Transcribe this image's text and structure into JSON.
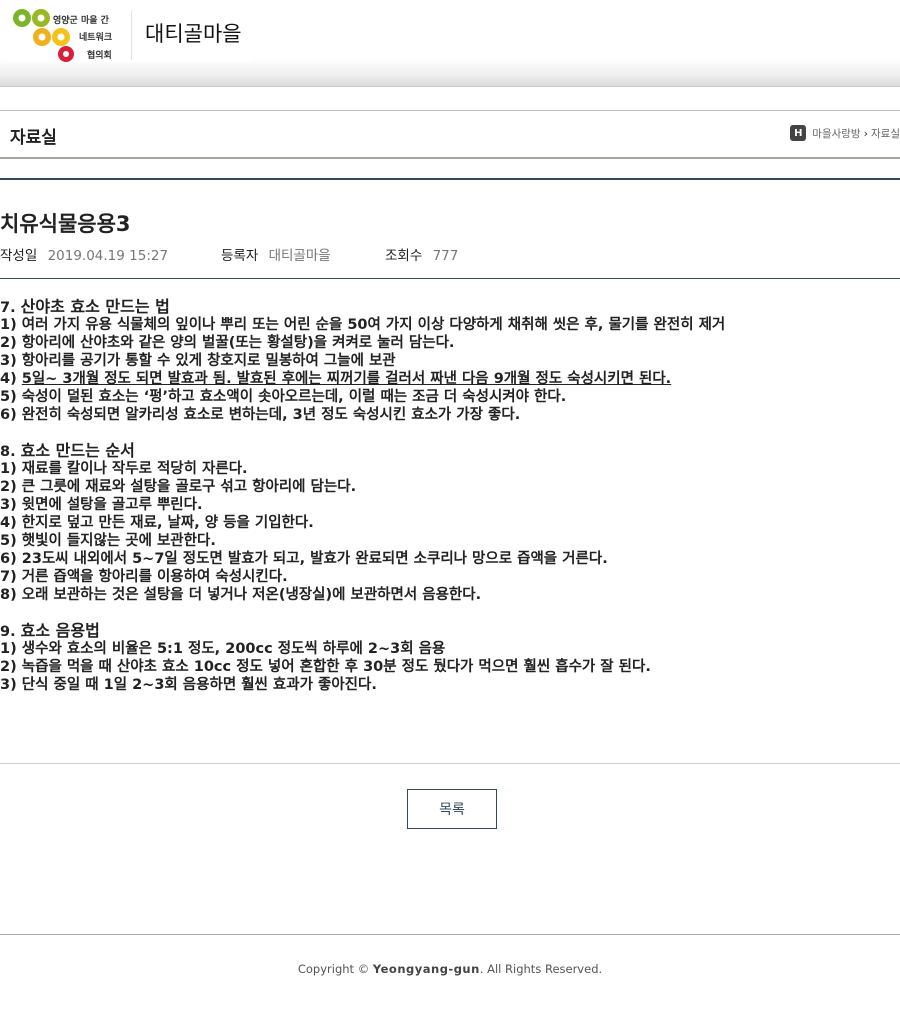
{
  "header": {
    "logo_lines": [
      "영양군 마을 간",
      "네트워크",
      "협의회"
    ],
    "village_name": "대티골마을"
  },
  "titlebar": {
    "section_title": "자료실",
    "home_icon_glyph": "H",
    "breadcrumb": [
      "마을사랑방",
      "자료실"
    ]
  },
  "post": {
    "title": "치유식물응용3",
    "meta": {
      "date_label": "작성일",
      "date_value": "2019.04.19 15:27",
      "author_label": "등록자",
      "author_value": "대티골마을",
      "views_label": "조회수",
      "views_value": "777"
    },
    "sections": [
      {
        "heading_num": "7.",
        "heading_text": "산야초 효소 만드는 법",
        "lines": [
          "1) 여러 가지 유용 식물체의 잎이나 뿌리 또는 어린 순을 50여 가지 이상 다양하게 채취해 씻은 후, 물기를 완전히 제거",
          "2) 항아리에 산야초와 같은 양의 벌꿀(또는 황설탕)을 켜켜로 눌러 담는다.",
          "3) 항아리를 공기가 통할 수 있게 창호지로 밀봉하여 그늘에 보관",
          "5일~ 3개월 정도 되면 발효과 됨. 발효된 후에는 찌꺼기를 걸러서 짜낸 다음 9개월 정도 숙성시키면 된다.",
          "5) 숙성이 덜된 효소는 ‘펑’하고 효소액이 솟아오르는데, 이럴 때는 조금 더 숙성시켜야 한다.",
          "6) 완전히 숙성되면 알카리성 효소로 변하는데, 3년 정도 숙성시킨 효소가 가장 좋다."
        ],
        "line4_prefix": "4) "
      },
      {
        "heading_num": "8.",
        "heading_text": "효소 만드는 순서",
        "lines": [
          "1) 재료를 칼이나 작두로 적당히 자른다.",
          "2) 큰 그릇에 재료와 설탕을 골로구 섞고 항아리에 담는다.",
          "3) 윗면에 설탕을 골고루 뿌린다.",
          "4) 한지로 덮고 만든 재료, 날짜, 양 등을 기입한다.",
          "5) 햇빛이 들지않는 곳에 보관한다.",
          "6) 23도씨 내외에서 5~7일 정도면 발효가 되고, 발효가 완료되면 소쿠리나 망으로 즙액을 거른다.",
          "7) 거른 즙액을 항아리를 이용하여 숙성시킨다.",
          "8) 오래 보관하는 것은 설탕을 더 넣거나 저온(냉장실)에 보관하면서 음용한다."
        ]
      },
      {
        "heading_num": "9.",
        "heading_text": "효소 음용법",
        "lines": [
          "1) 생수와 효소의 비율은 5:1 정도, 200cc 정도씩 하루에 2~3회 음용",
          "2) 녹즙을 먹을 때 산야초 효소 10cc 정도 넣어 혼합한 후 30분 정도 뒀다가 먹으면 훨씬 흡수가 잘 된다.",
          "3) 단식 중일 때 1일 2~3회 음용하면 훨씬 효과가 좋아진다."
        ]
      }
    ]
  },
  "list_button_label": "목록",
  "footer": {
    "copyright_prefix": "Copyright ©",
    "brand": "Yeongyang-gun",
    "suffix": ". All Rights Reserved."
  }
}
